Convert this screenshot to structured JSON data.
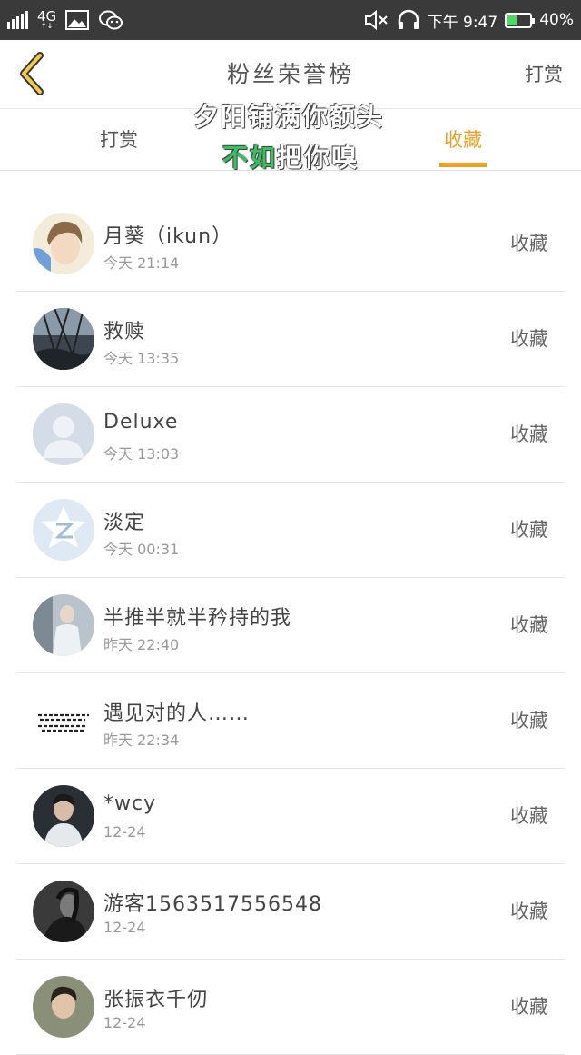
{
  "status_bar": {
    "network": "4G",
    "time": "下午 9:47",
    "battery": "40%",
    "battery_level": 0.4,
    "icons": [
      "signal-icon",
      "image-icon",
      "wechat-icon",
      "mute-icon",
      "headphones-icon"
    ]
  },
  "header": {
    "title": "粉丝荣誉榜",
    "action": "打赏",
    "back_icon": "chevron-left-icon"
  },
  "tabs": [
    {
      "label": "打赏",
      "active": false
    },
    {
      "label": "",
      "active": false
    },
    {
      "label": "收藏",
      "active": true
    }
  ],
  "lyrics": {
    "line1": "夕阳铺满你额头",
    "line2_sung": "不如",
    "line2_rest": "把你嗅"
  },
  "accent_color": "#f0a020",
  "items": [
    {
      "name": "月葵（ikun）",
      "time": "今天 21:14",
      "action": "收藏"
    },
    {
      "name": "救赎",
      "time": "今天 13:35",
      "action": "收藏"
    },
    {
      "name": "Deluxe",
      "time": "今天 13:03",
      "action": "收藏"
    },
    {
      "name": "淡定",
      "time": "今天 00:31",
      "action": "收藏"
    },
    {
      "name": "半推半就半矜持的我",
      "time": "昨天 22:40",
      "action": "收藏"
    },
    {
      "name": "遇见对的人……",
      "time": "昨天 22:34",
      "action": "收藏"
    },
    {
      "name": "*wcy",
      "time": "12-24",
      "action": "收藏"
    },
    {
      "name": "游客1563517556548",
      "time": "12-24",
      "action": "收藏"
    },
    {
      "name": "张振衣千仞",
      "time": "12-24",
      "action": "收藏"
    }
  ]
}
